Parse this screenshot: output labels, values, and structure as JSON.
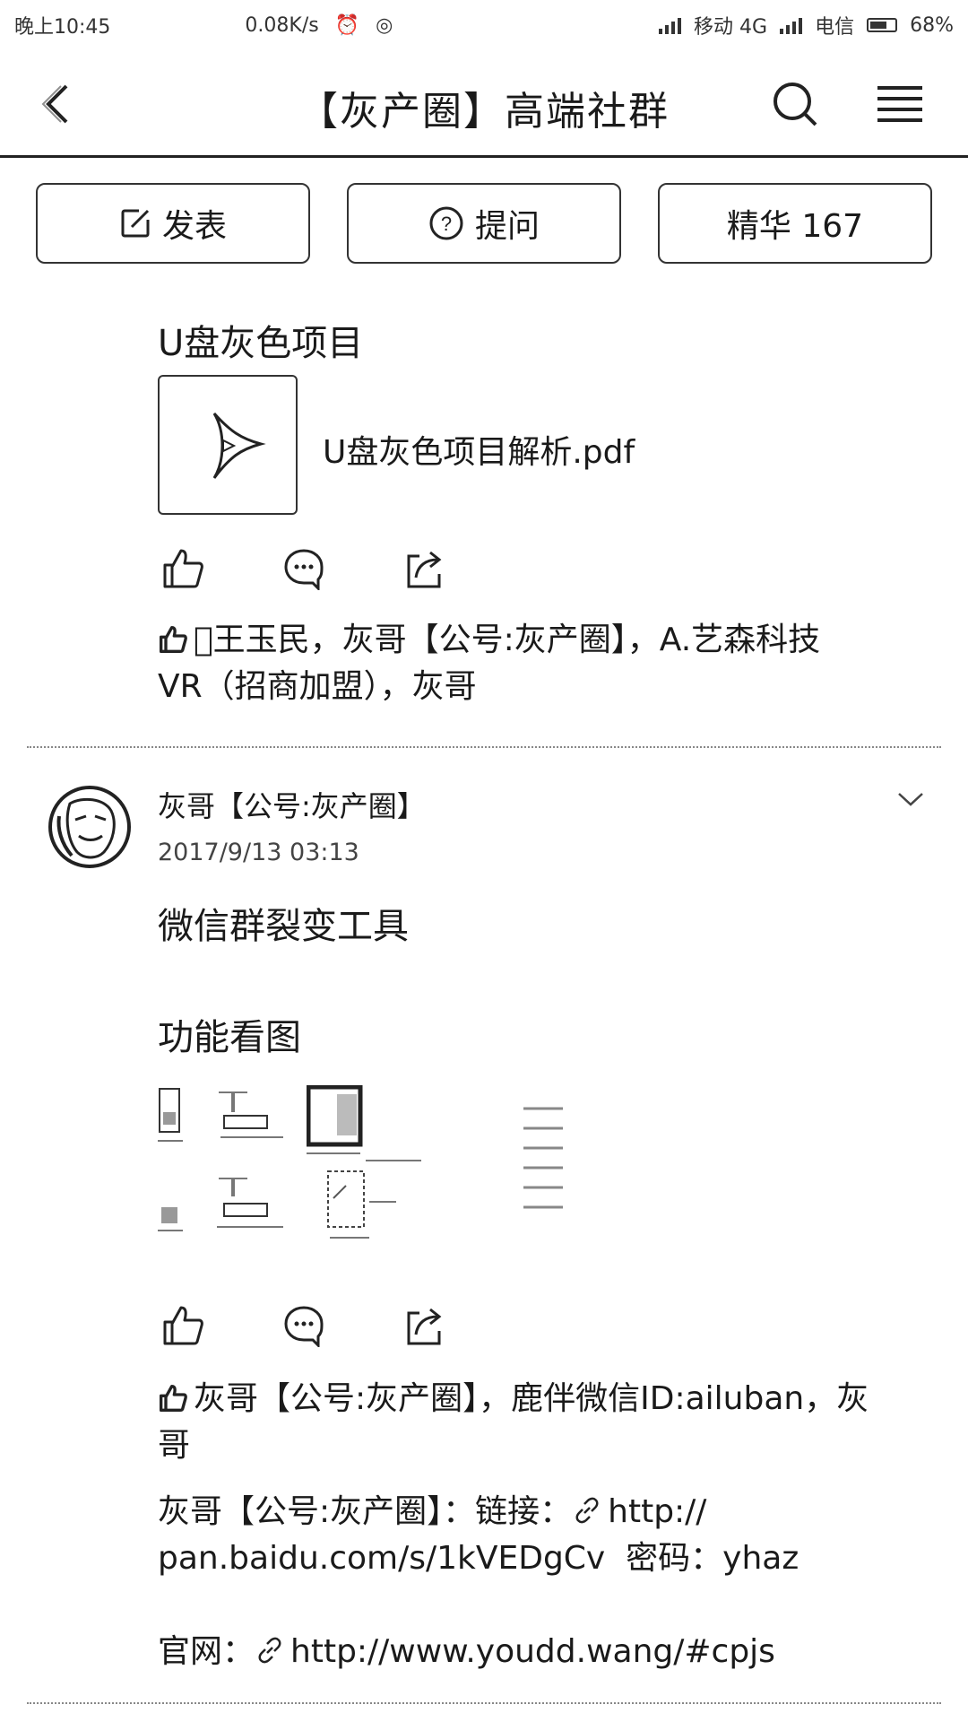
{
  "status_bar": {
    "time": "晚上10:45",
    "speed": "0.08K/s",
    "carrier1": "移动 4G",
    "carrier2": "电信",
    "battery": "68%"
  },
  "header": {
    "title": "【灰产圈】高端社群"
  },
  "actions": {
    "publish": "发表",
    "ask": "提问",
    "featured": "精华 167"
  },
  "post1": {
    "title": "U盘灰色项目",
    "file_name": "U盘灰色项目解析.pdf",
    "likers_line1": "\u0000王玉民，灰哥【公号:灰产圈】，A.艺森科技",
    "likers_line2": "VR（招商加盟），灰哥"
  },
  "post2": {
    "author": "灰哥【公号:灰产圈】",
    "date": "2017/9/13 03:13",
    "body_line1": "微信群裂变工具",
    "body_line2": "功能看图",
    "likers_line1": "灰哥【公号:灰产圈】，鹿伴微信ID:ailuban，灰",
    "likers_line2": "哥",
    "comment1_prefix": "灰哥【公号:灰产圈】：链接：",
    "comment1_url1": "http://",
    "comment1_url2": "pan.baidu.com/s/1kVEDgCv",
    "comment1_password": "密码：yhaz",
    "comment2_prefix": "官网：",
    "comment2_url": "http://www.youdd.wang/#cpjs"
  },
  "icons": {
    "back": "chevron-left-icon",
    "search": "search-icon",
    "menu": "menu-icon",
    "edit": "edit-icon",
    "question": "question-circle-icon",
    "like": "thumbs-up-icon",
    "comment": "comment-icon",
    "share": "share-icon",
    "link": "link-icon",
    "pdf": "pdf-file-icon",
    "chevron_down": "chevron-down-icon"
  }
}
